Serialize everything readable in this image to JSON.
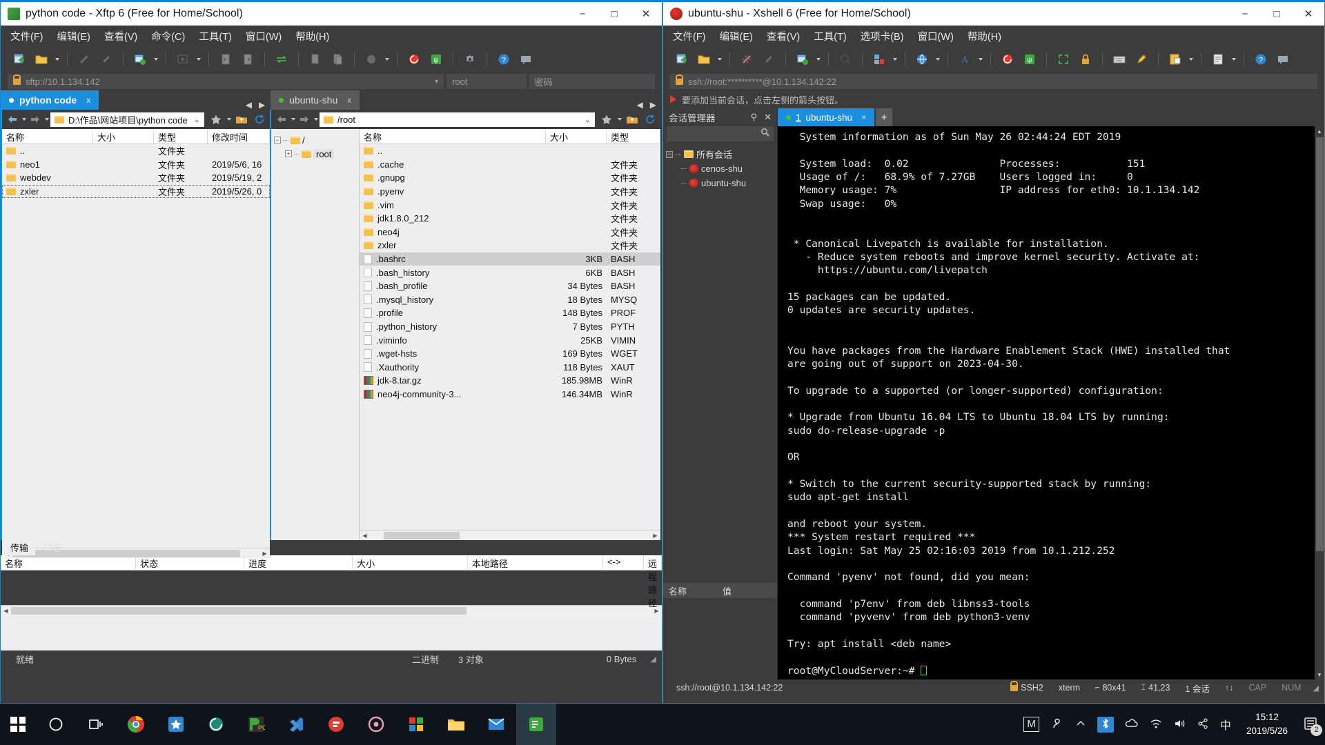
{
  "xftp": {
    "title": "python code - Xftp 6 (Free for Home/School)",
    "window_buttons": {
      "minimize": "−",
      "maximize": "□",
      "close": "✕"
    },
    "menu": [
      "文件(F)",
      "编辑(E)",
      "查看(V)",
      "命令(C)",
      "工具(T)",
      "窗口(W)",
      "帮助(H)"
    ],
    "address": {
      "url": "sftp://10.1.134.142",
      "user": "root",
      "password_placeholder": "密码"
    },
    "tabs": [
      {
        "label": "python code",
        "close": "x",
        "active": true,
        "dot_color": "#ffffff"
      },
      {
        "label": "ubuntu-shu",
        "close": "x",
        "active": false,
        "dot_color": "#3fc43f"
      }
    ],
    "local": {
      "path": "D:\\作品\\网站项目\\python code",
      "columns": [
        "名称",
        "大小",
        "类型",
        "修改时间"
      ],
      "rows": [
        {
          "name": "..",
          "size": "",
          "type": "文件夹",
          "date": "",
          "icon": "folder-icon"
        },
        {
          "name": "neo1",
          "size": "",
          "type": "文件夹",
          "date": "2019/5/6, 16",
          "icon": "folder-icon"
        },
        {
          "name": "webdev",
          "size": "",
          "type": "文件夹",
          "date": "2019/5/19, 2",
          "icon": "folder-icon"
        },
        {
          "name": "zxler",
          "size": "",
          "type": "文件夹",
          "date": "2019/5/26, 0",
          "icon": "folder-icon",
          "focused": true
        }
      ]
    },
    "remote": {
      "path": "/root",
      "tree": [
        {
          "label": "/",
          "expander": "−",
          "depth": 0,
          "selected": false
        },
        {
          "label": "root",
          "expander": "+",
          "depth": 1,
          "selected": true
        }
      ],
      "columns": [
        "名称",
        "大小",
        "类型"
      ],
      "rows": [
        {
          "name": "..",
          "size": "",
          "type": "",
          "icon": "folder-icon"
        },
        {
          "name": ".cache",
          "size": "",
          "type": "文件夹",
          "icon": "folder-icon"
        },
        {
          "name": ".gnupg",
          "size": "",
          "type": "文件夹",
          "icon": "folder-icon"
        },
        {
          "name": ".pyenv",
          "size": "",
          "type": "文件夹",
          "icon": "folder-icon"
        },
        {
          "name": ".vim",
          "size": "",
          "type": "文件夹",
          "icon": "folder-icon"
        },
        {
          "name": "jdk1.8.0_212",
          "size": "",
          "type": "文件夹",
          "icon": "folder-icon"
        },
        {
          "name": "neo4j",
          "size": "",
          "type": "文件夹",
          "icon": "folder-icon"
        },
        {
          "name": "zxler",
          "size": "",
          "type": "文件夹",
          "icon": "folder-icon"
        },
        {
          "name": ".bashrc",
          "size": "3KB",
          "type": "BASH",
          "icon": "file-icon",
          "selected": true
        },
        {
          "name": ".bash_history",
          "size": "6KB",
          "type": "BASH",
          "icon": "file-icon"
        },
        {
          "name": ".bash_profile",
          "size": "34 Bytes",
          "type": "BASH",
          "icon": "file-icon"
        },
        {
          "name": ".mysql_history",
          "size": "18 Bytes",
          "type": "MYSQ",
          "icon": "file-icon"
        },
        {
          "name": ".profile",
          "size": "148 Bytes",
          "type": "PROF",
          "icon": "file-icon"
        },
        {
          "name": ".python_history",
          "size": "7 Bytes",
          "type": "PYTH",
          "icon": "file-icon"
        },
        {
          "name": ".viminfo",
          "size": "25KB",
          "type": "VIMIN",
          "icon": "file-icon"
        },
        {
          "name": ".wget-hsts",
          "size": "169 Bytes",
          "type": "WGET",
          "icon": "file-icon"
        },
        {
          "name": ".Xauthority",
          "size": "118 Bytes",
          "type": "XAUT",
          "icon": "file-icon"
        },
        {
          "name": "jdk-8.tar.gz",
          "size": "185.98MB",
          "type": "WinR",
          "icon": "archive-icon"
        },
        {
          "name": "neo4j-community-3...",
          "size": "146.34MB",
          "type": "WinR",
          "icon": "archive-icon"
        }
      ]
    },
    "transfer": {
      "tabs": [
        "传输",
        "日志"
      ],
      "columns": [
        "名称",
        "状态",
        "进度",
        "大小",
        "本地路径",
        "<->",
        "远程路径"
      ]
    },
    "status": {
      "ready": "就绪",
      "mode": "二进制",
      "objects": "3 对象",
      "bytes": "0 Bytes"
    }
  },
  "xshell": {
    "title": "ubuntu-shu - Xshell 6 (Free for Home/School)",
    "window_buttons": {
      "minimize": "−",
      "maximize": "□",
      "close": "✕"
    },
    "menu": [
      "文件(F)",
      "编辑(E)",
      "查看(V)",
      "工具(T)",
      "选项卡(B)",
      "窗口(W)",
      "帮助(H)"
    ],
    "address": "ssh://root:**********@10.1.134.142:22",
    "notice": "要添加当前会话，点击左侧的箭头按钮。",
    "session_manager": {
      "title": "会话管理器",
      "pin": "📌",
      "close": "✕",
      "search_placeholder": "",
      "root": "所有会话",
      "sessions": [
        "cenos-shu",
        "ubuntu-shu"
      ],
      "props_columns": [
        "名称",
        "值"
      ]
    },
    "terminal_tabs": [
      {
        "index": "1",
        "label": "ubuntu-shu",
        "close": "×",
        "active": true
      }
    ],
    "new_tab_button": "+",
    "terminal_lines": [
      "  System information as of Sun May 26 02:44:24 EDT 2019",
      "",
      "  System load:  0.02               Processes:           151",
      "  Usage of /:   68.9% of 7.27GB    Users logged in:     0",
      "  Memory usage: 7%                 IP address for eth0: 10.1.134.142",
      "  Swap usage:   0%",
      "",
      "",
      " * Canonical Livepatch is available for installation.",
      "   - Reduce system reboots and improve kernel security. Activate at:",
      "     https://ubuntu.com/livepatch",
      "",
      "15 packages can be updated.",
      "0 updates are security updates.",
      "",
      "",
      "You have packages from the Hardware Enablement Stack (HWE) installed that",
      "are going out of support on 2023-04-30.",
      "",
      "To upgrade to a supported (or longer-supported) configuration:",
      "",
      "* Upgrade from Ubuntu 16.04 LTS to Ubuntu 18.04 LTS by running:",
      "sudo do-release-upgrade -p",
      "",
      "OR",
      "",
      "* Switch to the current security-supported stack by running:",
      "sudo apt-get install",
      "",
      "and reboot your system.",
      "*** System restart required ***",
      "Last login: Sat May 25 02:16:03 2019 from 10.1.212.252",
      "",
      "Command 'pyenv' not found, did you mean:",
      "",
      "  command 'p7env' from deb libnss3-tools",
      "  command 'pyvenv' from deb python3-venv",
      "",
      "Try: apt install <deb name>",
      ""
    ],
    "prompt": "root@MyCloudServer:~# ",
    "status": {
      "connection": "ssh://root@10.1.134.142:22",
      "protocol": "SSH2",
      "term": "xterm",
      "size": "80x41",
      "cursor": "41,23",
      "sessions": "1 会话",
      "cap": "CAP",
      "num": "NUM"
    }
  },
  "taskbar": {
    "start": "start-button",
    "items": [
      "cortana-search",
      "task-view",
      "chrome",
      "store-app",
      "snail-app",
      "pycharm",
      "vscode",
      "filezilla",
      "recorder-app",
      "colorful-app",
      "file-explorer",
      "mail-app",
      "xftp-app"
    ],
    "tray": [
      "M",
      "people-icon",
      "chevron-up",
      "bluetooth",
      "onedrive",
      "network",
      "volume",
      "share",
      "ime"
    ],
    "ime": "中",
    "clock": {
      "time": "15:12",
      "date": "2019/5/26"
    },
    "notifications": "2"
  }
}
